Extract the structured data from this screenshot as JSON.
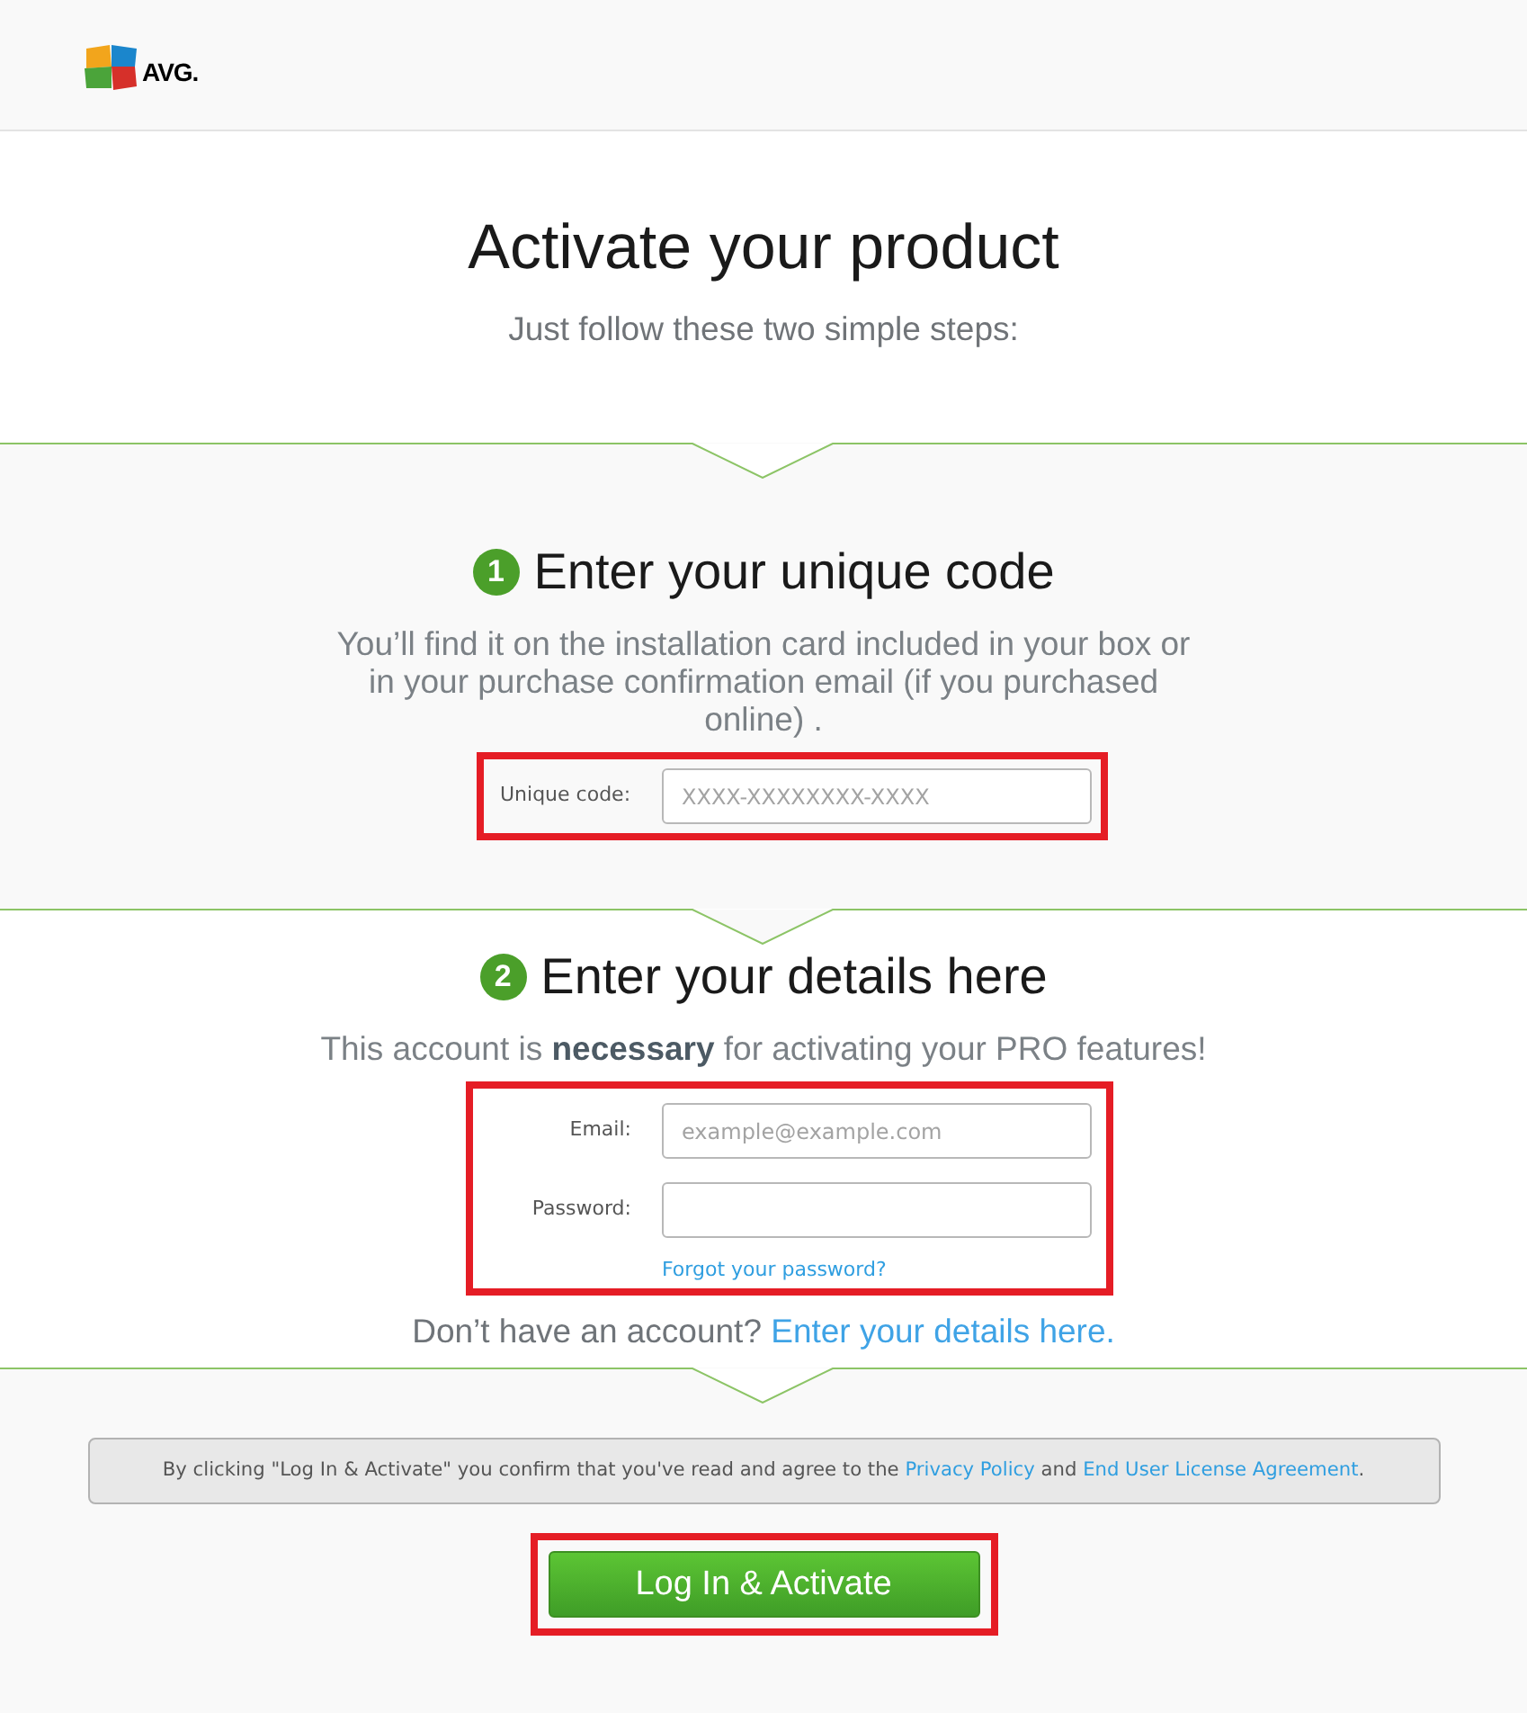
{
  "header": {
    "logo_text": "AVG."
  },
  "hero": {
    "title": "Activate your product",
    "subtitle": "Just follow these two simple steps:"
  },
  "steps": [
    {
      "number": "1",
      "title": "Enter your unique code",
      "description": "You’ll find it on the installation card included in your box or in your purchase confirmation email (if you purchased online) .",
      "highlighted": true,
      "fields": [
        {
          "label": "Unique code:",
          "placeholder": "XXXX-XXXXXXXX-XXXX"
        }
      ]
    },
    {
      "number": "2",
      "title": "Enter your details here",
      "description": "This account is **necessary** for activating your PRO features!",
      "highlighted": true,
      "fields": [
        {
          "label": "Email:",
          "placeholder": "example@example.com"
        },
        {
          "label": "Password:"
        }
      ],
      "link": "Forgot your password?",
      "signup": {
        "text": "Don’t have an account? ",
        "link": "Enter your details here."
      }
    }
  ],
  "terms": {
    "segments": [
      {
        "kind": "text",
        "text": "By clicking \"Log In & Activate\" you confirm that you've read and agree to the "
      },
      {
        "kind": "link",
        "text": "Privacy Policy"
      },
      {
        "kind": "text",
        "text": " and "
      },
      {
        "kind": "link",
        "text": "End User License Agreement"
      },
      {
        "kind": "text",
        "text": "."
      }
    ]
  },
  "button": {
    "label": "Log In & Activate",
    "highlighted": true
  }
}
